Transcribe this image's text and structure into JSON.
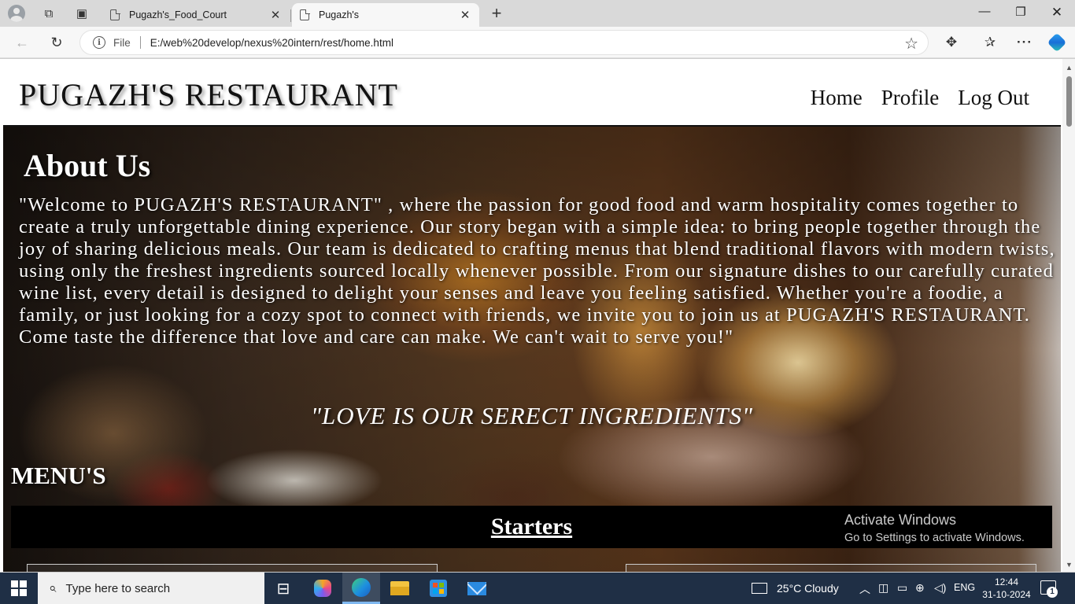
{
  "browser": {
    "tabs": [
      {
        "title": "Pugazh's_Food_Court",
        "close": "✕"
      },
      {
        "title": "Pugazh's",
        "close": "✕"
      }
    ],
    "new_tab": "+",
    "window": {
      "minimize": "—",
      "maximize": "❐",
      "close": "✕"
    },
    "address": {
      "scheme_label": "File",
      "url": "E:/web%20develop/nexus%20intern/rest/home.html"
    }
  },
  "site": {
    "logo": "PUGAZH'S RESTAURANT",
    "nav": [
      "Home",
      "Profile",
      "Log Out"
    ],
    "about_title": "About Us",
    "about_text": "\"Welcome to PUGAZH'S RESTAURANT\" , where the passion for good food and warm hospitality comes together to create a truly unforgettable dining experience. Our story began with a simple idea: to bring people together through the joy of sharing delicious meals. Our team is dedicated to crafting menus that blend traditional flavors with modern twists, using only the freshest ingredients sourced locally whenever possible. From our signature dishes to our carefully curated wine list, every detail is designed to delight your senses and leave you feeling satisfied. Whether you're a foodie, a family, or just looking for a cozy spot to connect with friends, we invite you to join us at PUGAZH'S RESTAURANT. Come taste the difference that love and care can make. We can't wait to serve you!\"",
    "tagline": "\"LOVE IS OUR SERECT INGREDIENTS\"",
    "menu_title": "MENU'S",
    "section_title": "Starters"
  },
  "watermark": {
    "line1": "Activate Windows",
    "line2": "Go to Settings to activate Windows."
  },
  "taskbar": {
    "search_placeholder": "Type here to search",
    "weather": "25°C  Cloudy",
    "language": "ENG",
    "time": "12:44",
    "date": "31-10-2024",
    "notification_count": "1"
  }
}
